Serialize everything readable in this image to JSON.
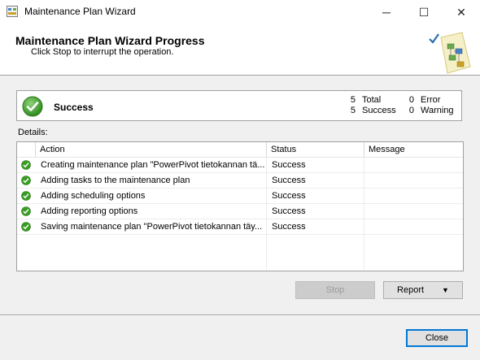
{
  "window": {
    "title": "Maintenance Plan Wizard",
    "minimize_glyph": "─",
    "maximize_glyph": "☐",
    "close_glyph": "✕"
  },
  "header": {
    "title": "Maintenance Plan Wizard Progress",
    "subtitle": "Click Stop to interrupt the operation."
  },
  "summary": {
    "status": "Success",
    "total_count": "5",
    "total_label": "Total",
    "success_count": "5",
    "success_label": "Success",
    "error_count": "0",
    "error_label": "Error",
    "warning_count": "0",
    "warning_label": "Warning"
  },
  "details": {
    "label": "Details:",
    "columns": [
      "Action",
      "Status",
      "Message"
    ],
    "rows": [
      {
        "action": "Creating maintenance plan \"PowerPivot tietokannan tä...",
        "status": "Success",
        "message": ""
      },
      {
        "action": "Adding tasks to the maintenance plan",
        "status": "Success",
        "message": ""
      },
      {
        "action": "Adding scheduling options",
        "status": "Success",
        "message": ""
      },
      {
        "action": "Adding reporting options",
        "status": "Success",
        "message": ""
      },
      {
        "action": "Saving maintenance plan \"PowerPivot tietokannan täy...",
        "status": "Success",
        "message": ""
      }
    ]
  },
  "buttons": {
    "stop": "Stop",
    "report": "Report",
    "report_caret": "▼",
    "close": "Close"
  },
  "colors": {
    "success_green": "#3a9d23",
    "accent": "#0078d7"
  }
}
